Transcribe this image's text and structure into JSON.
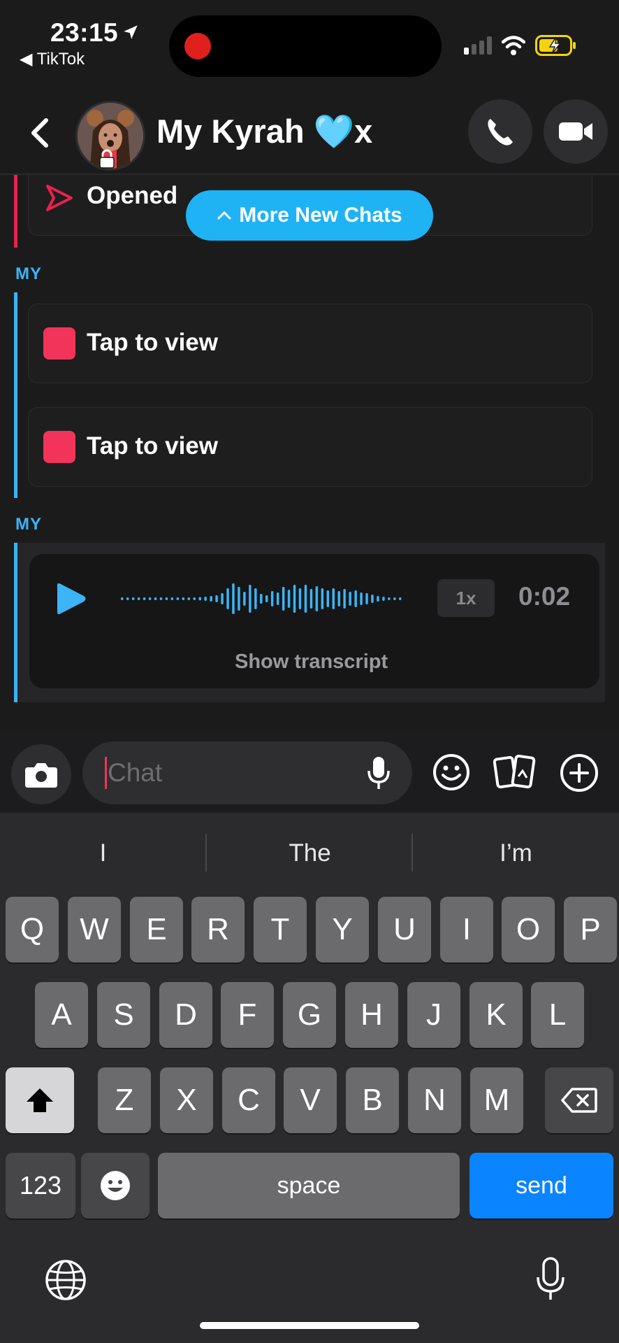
{
  "status_bar": {
    "time": "23:15",
    "back_app": "◀ TikTok"
  },
  "header": {
    "title": "My Kyrah 🩵x"
  },
  "messages": {
    "opened_label": "Opened",
    "more_new_chats": "More New Chats",
    "sender_1": "MY",
    "tap_to_view_1": "Tap to view",
    "tap_to_view_2": "Tap to view",
    "sender_2": "MY",
    "voice": {
      "speed": "1x",
      "duration": "0:02",
      "show_transcript": "Show transcript"
    }
  },
  "input": {
    "placeholder": "Chat"
  },
  "keyboard": {
    "suggestions": [
      "I",
      "The",
      "I’m"
    ],
    "row1": [
      "Q",
      "W",
      "E",
      "R",
      "T",
      "Y",
      "U",
      "I",
      "O",
      "P"
    ],
    "row2": [
      "A",
      "S",
      "D",
      "F",
      "G",
      "H",
      "J",
      "K",
      "L"
    ],
    "row3": [
      "Z",
      "X",
      "C",
      "V",
      "B",
      "N",
      "M"
    ],
    "numbers_key": "123",
    "space_key": "space",
    "send_key": "send"
  },
  "colors": {
    "accent_blue": "#1fb3f5",
    "snap_pink": "#f2345a",
    "send_blue": "#0a84ff"
  }
}
